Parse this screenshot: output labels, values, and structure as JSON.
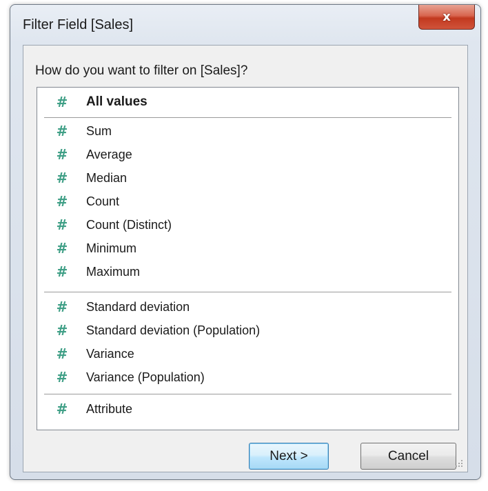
{
  "window": {
    "title": "Filter Field [Sales]",
    "close_symbol": "x"
  },
  "prompt": "How do you want to filter on [Sales]?",
  "list": {
    "icon_glyph": "#",
    "items": [
      {
        "label": "All values",
        "bold": true
      },
      {
        "label": "Sum"
      },
      {
        "label": "Average"
      },
      {
        "label": "Median"
      },
      {
        "label": "Count"
      },
      {
        "label": "Count (Distinct)"
      },
      {
        "label": "Minimum"
      },
      {
        "label": "Maximum"
      },
      {
        "label": "Standard deviation"
      },
      {
        "label": "Standard deviation (Population)"
      },
      {
        "label": "Variance"
      },
      {
        "label": "Variance (Population)"
      },
      {
        "label": "Attribute"
      }
    ]
  },
  "buttons": {
    "next": "Next >",
    "cancel": "Cancel"
  },
  "colors": {
    "hash_icon": "#3f9f86",
    "close_button": "#c2391f",
    "default_button_border": "#3c7fb1"
  }
}
